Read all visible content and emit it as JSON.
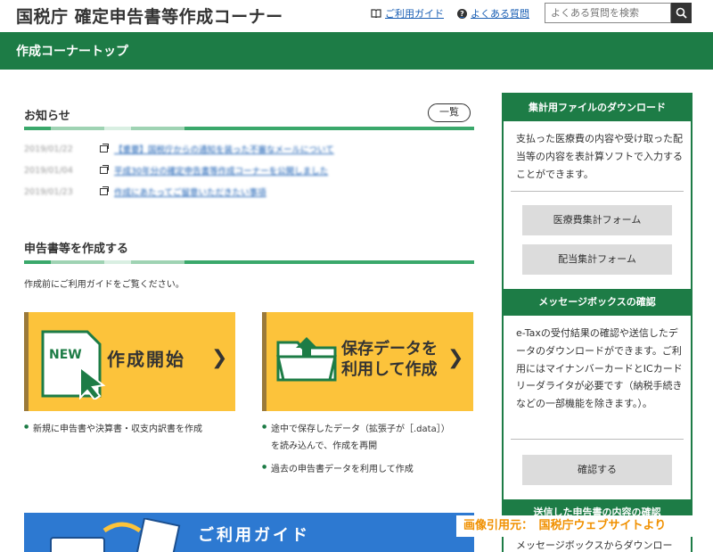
{
  "header": {
    "title": "国税庁 確定申告書等作成コーナー",
    "guide_link": "ご利用ガイド",
    "faq_link": "よくある質問",
    "search_placeholder": "よくある質問を検索"
  },
  "nav": {
    "top_label": "作成コーナートップ"
  },
  "news": {
    "title": "お知らせ",
    "all_button": "一覧",
    "items": [
      {
        "date": "2019/01/22",
        "text": "【重要】国税庁からの通知を装った不審なメールについて"
      },
      {
        "date": "2019/01/04",
        "text": "平成30年分の確定申告書等作成コーナーを公開しました"
      },
      {
        "date": "2019/01/23",
        "text": "作成にあたってご留意いただきたい事項"
      }
    ]
  },
  "create": {
    "title": "申告書等を作成する",
    "lead": "作成前にご利用ガイドをご覧ください。",
    "new_card": {
      "badge": "NEW",
      "label": "作成開始"
    },
    "saved_card": {
      "label_line1": "保存データを",
      "label_line2": "利用して作成"
    },
    "new_bullets": [
      "新規に申告書や決算書・収支内訳書を作成"
    ],
    "saved_bullets": [
      "途中で保存したデータ（拡張子が［.data］）",
      "を読み込んで、作成を再開",
      "過去の申告書データを利用して作成"
    ]
  },
  "guide_banner": {
    "label": "ご利用ガイド"
  },
  "sidebar": {
    "download": {
      "title": "集計用ファイルのダウンロード",
      "text": "支払った医療費の内容や受け取った配当等の内容を表計算ソフトで入力することができます。",
      "buttons": [
        "医療費集計フォーム",
        "配当集計フォーム"
      ]
    },
    "messagebox": {
      "title": "メッセージボックスの確認",
      "text": "e-Taxの受付結果の確認や送信したデータのダウンロードができます。ご利用にはマイナンバーカードとICカードリーダライタが必要です（納税手続きなどの一部機能を除きます。）。",
      "button": "確認する"
    },
    "next": {
      "title": "送信した申告書の内容の確認",
      "text": "メッセージボックスからダウンロー"
    }
  },
  "watermark": "画像引用元：　国税庁ウェブサイトより",
  "colors": {
    "brand_green": "#1d7c46",
    "card_yellow": "#fcc33b",
    "link_blue": "#1a5fb4",
    "banner_blue": "#2d79d1"
  }
}
